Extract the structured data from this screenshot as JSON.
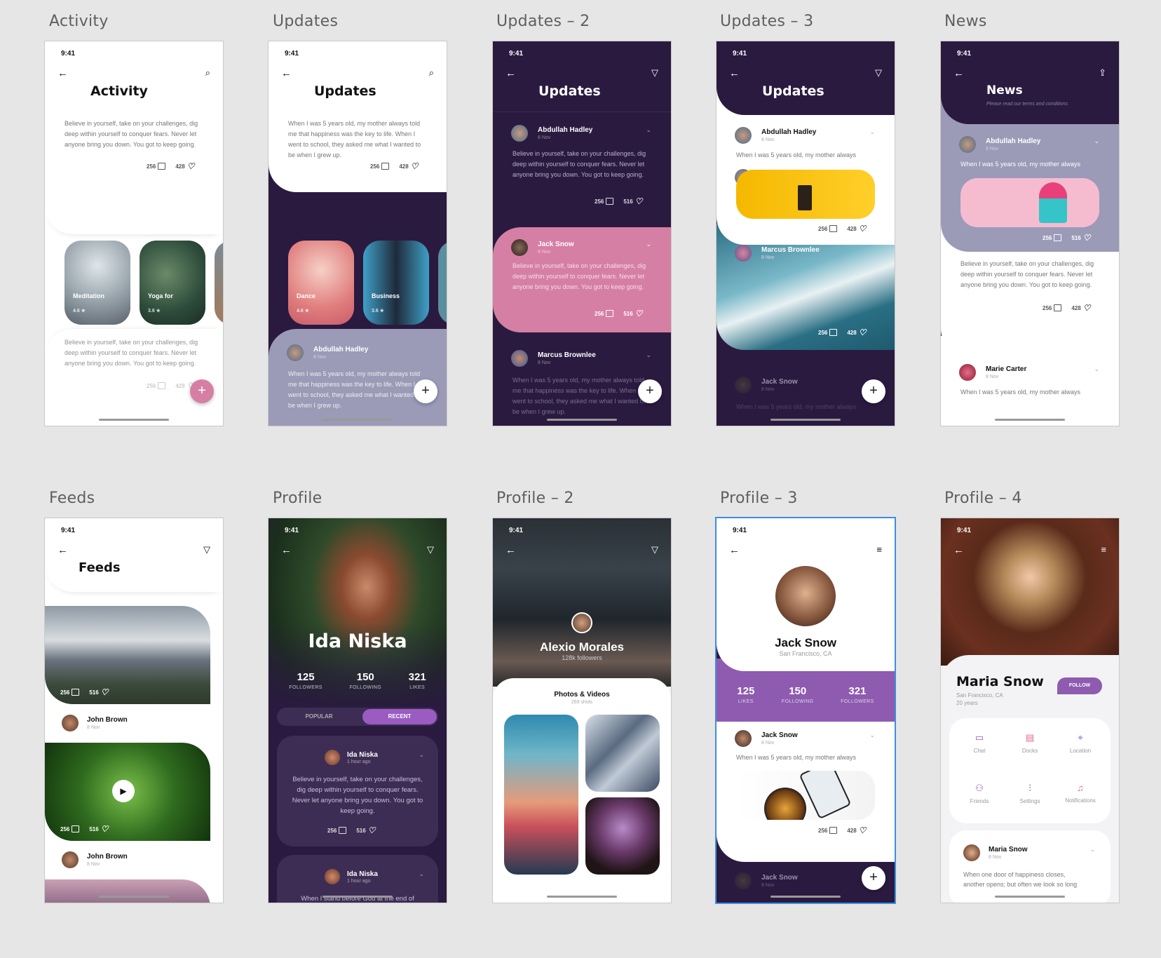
{
  "status_time": "9:41",
  "common": {
    "posts": {
      "comments": "256",
      "likes_428": "428",
      "likes_516": "516"
    },
    "date": "8 Nov",
    "text_believe": "Believe in yourself, take on your challenges, dig deep within yourself to conquer fears. Never let anyone bring you down. You got to keep going.",
    "text_when_short": "When I was 5 years old, my mother always",
    "text_when_long": "When I was 5 years old, my mother always told me that happiness was the key to life. When I went to school, they asked me what I wanted to be when I grew up."
  },
  "screens": {
    "activity": {
      "label": "Activity",
      "title": "Activity",
      "thumbs": [
        {
          "title": "Meditation",
          "rating": "4.6 ★"
        },
        {
          "title": "Yoga for",
          "rating": "3.6 ★"
        }
      ]
    },
    "updates": {
      "label": "Updates",
      "title": "Updates",
      "thumbs": [
        {
          "title": "Dance",
          "rating": "4.6 ★"
        },
        {
          "title": "Business",
          "rating": "3.6 ★"
        }
      ],
      "person": "Abdullah Hadley"
    },
    "updates2": {
      "label": "Updates – 2",
      "title": "Updates",
      "people": [
        "Abdullah Hadley",
        "Jack Snow",
        "Marcus Brownlee"
      ]
    },
    "updates3": {
      "label": "Updates – 3",
      "title": "Updates",
      "people": [
        "Abdullah Hadley",
        "Marcus Brownlee",
        "Jack Snow"
      ]
    },
    "news": {
      "label": "News",
      "title": "News",
      "subtitle": "Please read our terms and conditions",
      "people": [
        "Abdullah Hadley",
        "Marie Carter"
      ]
    },
    "feeds": {
      "label": "Feeds",
      "title": "Feeds",
      "people": [
        "John Brown",
        "John Brown"
      ]
    },
    "profile": {
      "label": "Profile",
      "name": "Ida Niska",
      "stats": [
        {
          "n": "125",
          "l": "FOLLOWERS"
        },
        {
          "n": "150",
          "l": "FOLLOWING"
        },
        {
          "n": "321",
          "l": "LIKES"
        }
      ],
      "tabs": [
        "POPULAR",
        "RECENT"
      ],
      "post_name": "Ida Niska",
      "post_time": "1 hour ago",
      "post2_text": "When I stand before God at the end of"
    },
    "profile2": {
      "label": "Profile – 2",
      "name": "Alexio Morales",
      "followers": "128k followers",
      "section": "Photos & Videos",
      "shots": "269 shots"
    },
    "profile3": {
      "label": "Profile – 3",
      "name": "Jack Snow",
      "location": "San Francisco, CA",
      "stats": [
        {
          "n": "125",
          "l": "LIKES"
        },
        {
          "n": "150",
          "l": "FOLLOWING"
        },
        {
          "n": "321",
          "l": "FOLLOWERS"
        }
      ],
      "people": [
        "Jack Snow",
        "Jack Snow"
      ]
    },
    "profile4": {
      "label": "Profile – 4",
      "name": "Maria Snow",
      "location": "San Francisco, CA",
      "age": "20 years",
      "follow": "FOLLOW",
      "menu": [
        "Chat",
        "Docks",
        "Location",
        "Friends",
        "Settings",
        "Notifications"
      ],
      "post_name": "Maria Snow",
      "post_text_1": "When one door of happiness closes,",
      "post_text_2": "another opens; but often we look so long"
    }
  },
  "colors": {
    "dark_purple": "#2a1a40",
    "pink": "#d67fa4",
    "lavender": "#9b9bb8",
    "violet": "#8e5bb0"
  }
}
